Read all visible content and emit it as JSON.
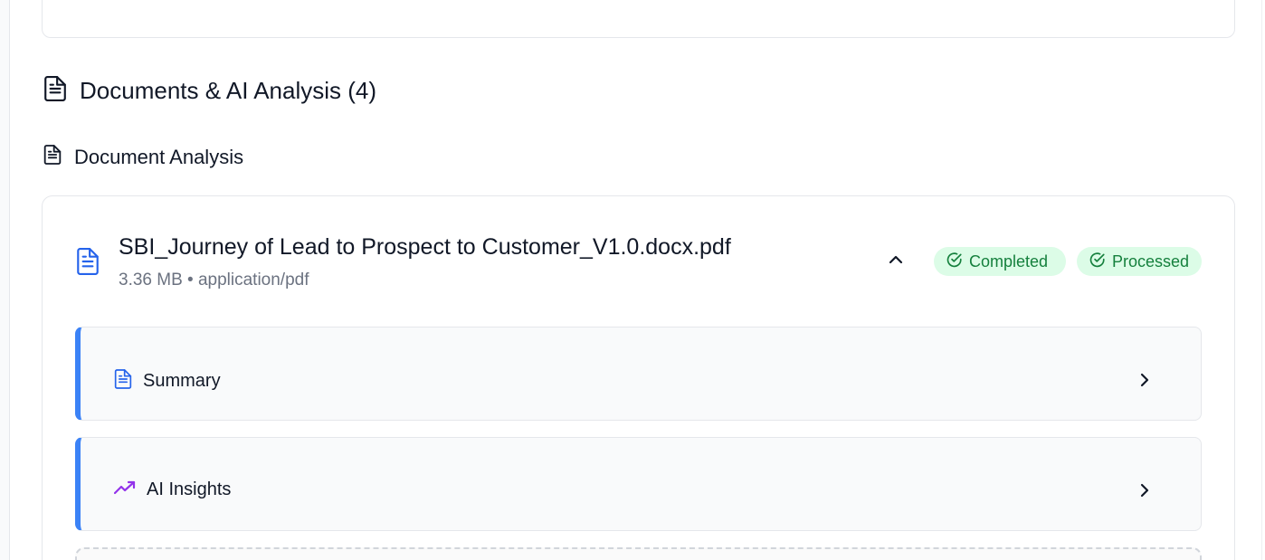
{
  "section": {
    "title": "Documents & AI Analysis (4)",
    "icon": "file-text-icon"
  },
  "analysis": {
    "title": "Document Analysis",
    "icon": "file-text-icon"
  },
  "document": {
    "name": "SBI_Journey of Lead to Prospect to Customer_V1.0.docx.pdf",
    "meta": "3.36 MB • application/pdf",
    "icon": "file-text-icon",
    "badges": [
      {
        "label": "Completed",
        "icon": "check-circle-icon",
        "color": "#15803d",
        "bg": "#dcfce7"
      },
      {
        "label": "Processed",
        "icon": "check-circle-icon",
        "color": "#15803d",
        "bg": "#dcfce7"
      }
    ]
  },
  "panels": [
    {
      "label": "Summary",
      "icon": "file-text-icon",
      "icon_color": "#2563eb"
    },
    {
      "label": "AI Insights",
      "icon": "trending-up-icon",
      "icon_color": "#9333ea"
    }
  ],
  "colors": {
    "accent": "#3b82f6",
    "tab_active": "#1f8ddb",
    "success_text": "#15803d",
    "success_bg": "#dcfce7"
  }
}
